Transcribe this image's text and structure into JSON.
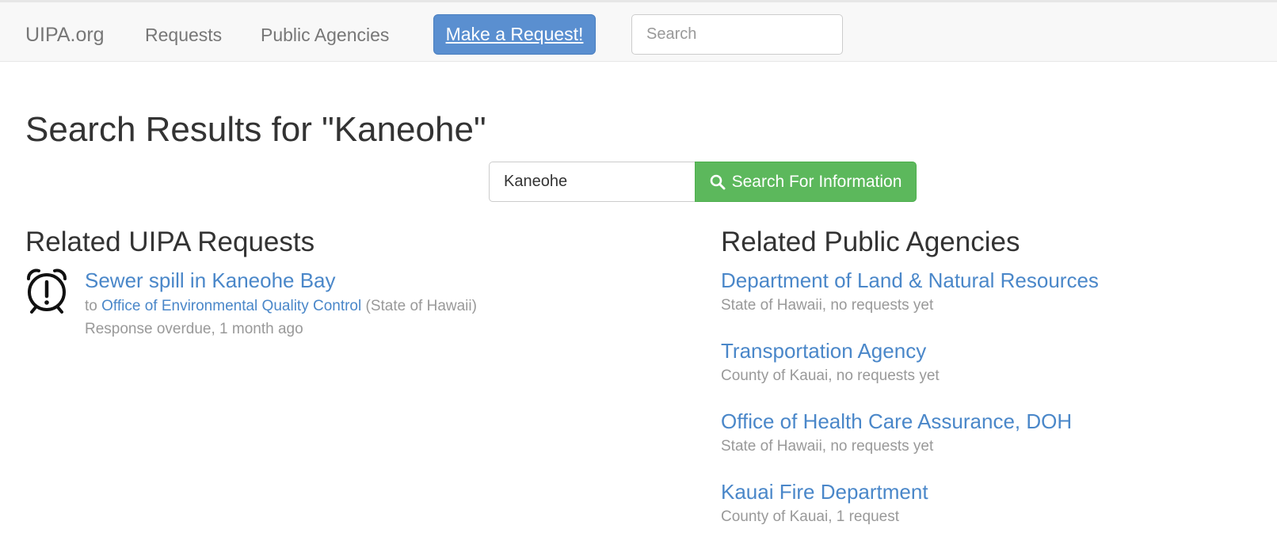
{
  "nav": {
    "brand": "UIPA.org",
    "links": [
      "Requests",
      "Public Agencies"
    ],
    "cta": "Make a Request!",
    "search_placeholder": "Search"
  },
  "page": {
    "title": "Search Results for \"Kaneohe\"",
    "search": {
      "value": "Kaneohe",
      "button_label": "Search For Information",
      "button_icon": "search-icon"
    }
  },
  "requests_section": {
    "heading": "Related UIPA Requests",
    "items": [
      {
        "icon": "alarm-clock-overdue-icon",
        "title": "Sewer spill in Kaneohe Bay",
        "to_prefix": "to",
        "agency": "Office of Environmental Quality Control",
        "jurisdiction": "(State of Hawaii)",
        "status": "Response overdue, 1 month ago"
      }
    ]
  },
  "agencies_section": {
    "heading": "Related Public Agencies",
    "items": [
      {
        "name": "Department of Land & Natural Resources",
        "subtitle": "State of Hawaii, no requests yet"
      },
      {
        "name": "Transportation Agency",
        "subtitle": "County of Kauai, no requests yet"
      },
      {
        "name": "Office of Health Care Assurance, DOH",
        "subtitle": "State of Hawaii, no requests yet"
      },
      {
        "name": "Kauai Fire Department",
        "subtitle": "County of Kauai, 1 request"
      }
    ]
  },
  "colors": {
    "link": "#4a87c9",
    "primary_button": "#5a8fd0",
    "success_button": "#5cb85c",
    "navbar_bg": "#f8f8f8",
    "muted_text": "#999999"
  }
}
